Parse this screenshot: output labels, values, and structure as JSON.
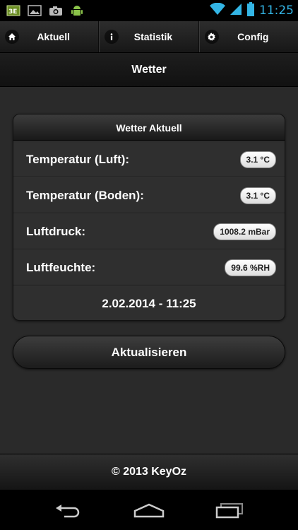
{
  "status_bar": {
    "time": "11:25",
    "notification_icons": [
      "app-icon",
      "image-icon",
      "camera-icon",
      "android-icon"
    ],
    "system_icons": [
      "wifi-icon",
      "signal-icon",
      "battery-icon"
    ],
    "accent_color": "#33b5e5"
  },
  "nav": {
    "items": [
      {
        "label": "Aktuell",
        "icon": "home-icon"
      },
      {
        "label": "Statistik",
        "icon": "info-icon"
      },
      {
        "label": "Config",
        "icon": "gear-icon"
      }
    ]
  },
  "header": {
    "title": "Wetter"
  },
  "weather_card": {
    "title": "Wetter Aktuell",
    "rows": [
      {
        "label": "Temperatur (Luft):",
        "value": "3.1 °C"
      },
      {
        "label": "Temperatur (Boden):",
        "value": "3.1 °C"
      },
      {
        "label": "Luftdruck:",
        "value": "1008.2 mBar"
      },
      {
        "label": "Luftfeuchte:",
        "value": "99.6 %RH"
      }
    ],
    "timestamp": "2.02.2014 - 11:25"
  },
  "refresh_button": {
    "label": "Aktualisieren"
  },
  "footer": {
    "text": "© 2013 KeyOz"
  },
  "system_nav": {
    "buttons": [
      "back-icon",
      "home-icon",
      "recent-apps-icon"
    ]
  }
}
